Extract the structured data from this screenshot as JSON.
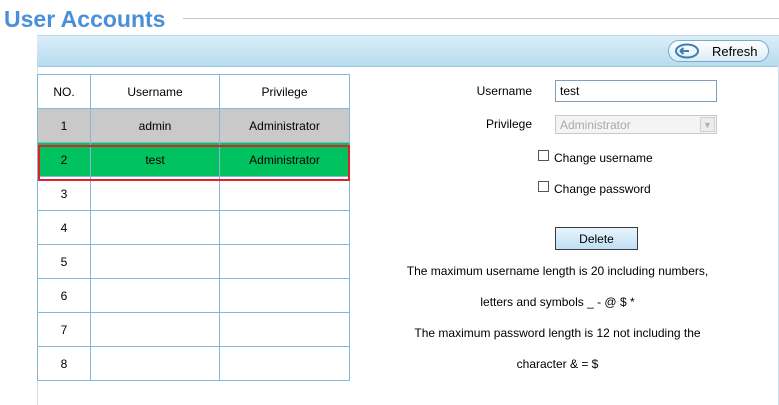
{
  "header": {
    "title": "User Accounts"
  },
  "toolbar": {
    "refresh_label": "Refresh"
  },
  "table": {
    "headers": {
      "no": "NO.",
      "username": "Username",
      "privilege": "Privilege"
    },
    "rows": [
      {
        "no": "1",
        "username": "admin",
        "privilege": "Administrator"
      },
      {
        "no": "2",
        "username": "test",
        "privilege": "Administrator"
      },
      {
        "no": "3",
        "username": "",
        "privilege": ""
      },
      {
        "no": "4",
        "username": "",
        "privilege": ""
      },
      {
        "no": "5",
        "username": "",
        "privilege": ""
      },
      {
        "no": "6",
        "username": "",
        "privilege": ""
      },
      {
        "no": "7",
        "username": "",
        "privilege": ""
      },
      {
        "no": "8",
        "username": "",
        "privilege": ""
      }
    ]
  },
  "form": {
    "username_label": "Username",
    "username_value": "test",
    "privilege_label": "Privilege",
    "privilege_value": "Administrator",
    "change_username_label": "Change username",
    "change_password_label": "Change password",
    "delete_label": "Delete"
  },
  "notes": {
    "line1": "The maximum username length is 20 including numbers,",
    "line2": "letters and symbols _ - @ $ *",
    "line3": "The maximum password length is 12 not including the",
    "line4": "character & = $"
  },
  "colors": {
    "title": "#4a90d9",
    "selected_row": "#00c35f",
    "highlight_outline": "#e0202a",
    "row_gray": "#c9c9c9"
  }
}
